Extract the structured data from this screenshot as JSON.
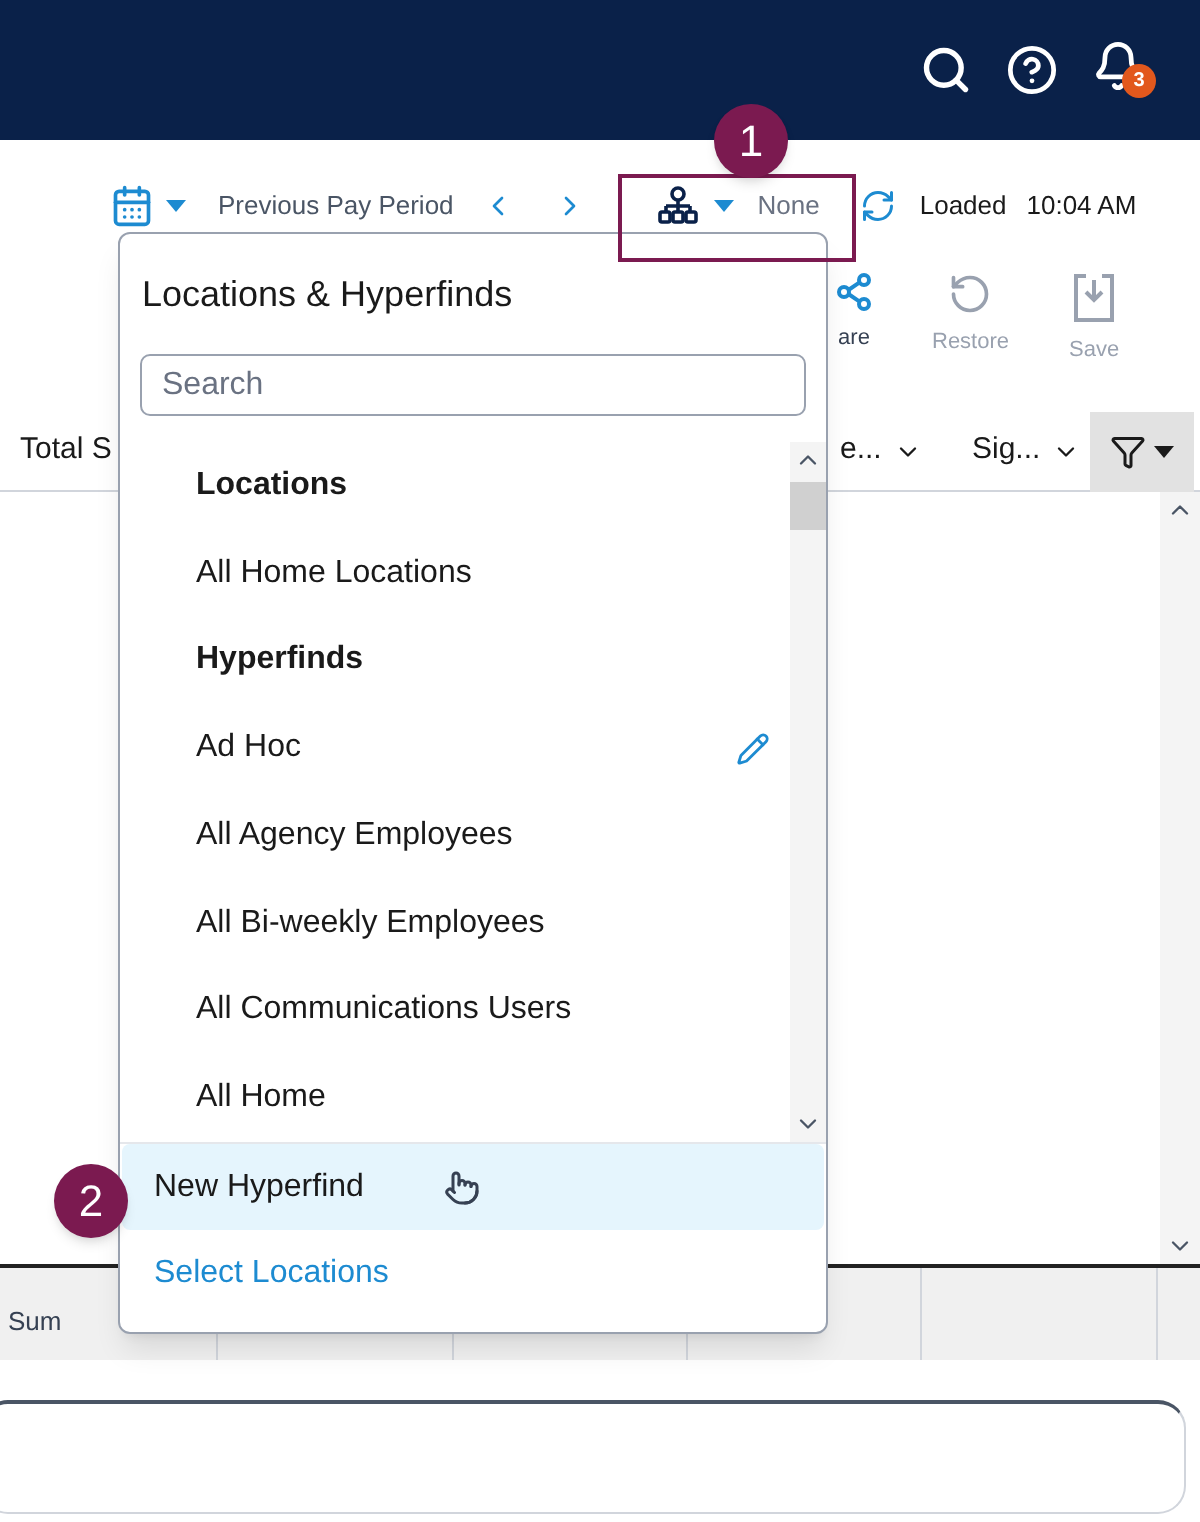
{
  "header": {
    "notification_count": "3"
  },
  "toolbar": {
    "period": "Previous Pay Period",
    "hyperfind_value": "None",
    "status": "Loaded",
    "time": "10:04 AM"
  },
  "actions": [
    {
      "label": "are",
      "kind": "share",
      "disabled": false
    },
    {
      "label": "Restore",
      "kind": "restore",
      "disabled": true
    },
    {
      "label": "Save",
      "kind": "save",
      "disabled": true
    }
  ],
  "table": {
    "columns": [
      {
        "label": "Total S"
      },
      {
        "label": "e...",
        "dropdown": true
      },
      {
        "label": "Sig...",
        "dropdown": true
      }
    ],
    "footer_label": "Sum"
  },
  "dropdown": {
    "title": "Locations & Hyperfinds",
    "search": {
      "placeholder": "Search"
    },
    "items": [
      {
        "label": "Locations",
        "kind": "heading"
      },
      {
        "label": "All Home Locations",
        "kind": "item",
        "editable": false
      },
      {
        "label": "Hyperfinds",
        "kind": "heading"
      },
      {
        "label": "Ad Hoc",
        "kind": "item",
        "editable": true
      },
      {
        "label": "All Agency Employees",
        "kind": "item",
        "editable": false
      },
      {
        "label": "All Bi-weekly Employees",
        "kind": "item",
        "editable": false
      },
      {
        "label": "All Communications Users",
        "kind": "item",
        "editable": false
      },
      {
        "label": "All Home",
        "kind": "item",
        "editable": false
      }
    ],
    "footer": [
      {
        "label": "New Hyperfind",
        "kind": "action",
        "hovered": true
      },
      {
        "label": "Select Locations",
        "kind": "link",
        "hovered": false
      }
    ]
  },
  "callouts": [
    {
      "label": "1"
    },
    {
      "label": "2"
    }
  ]
}
